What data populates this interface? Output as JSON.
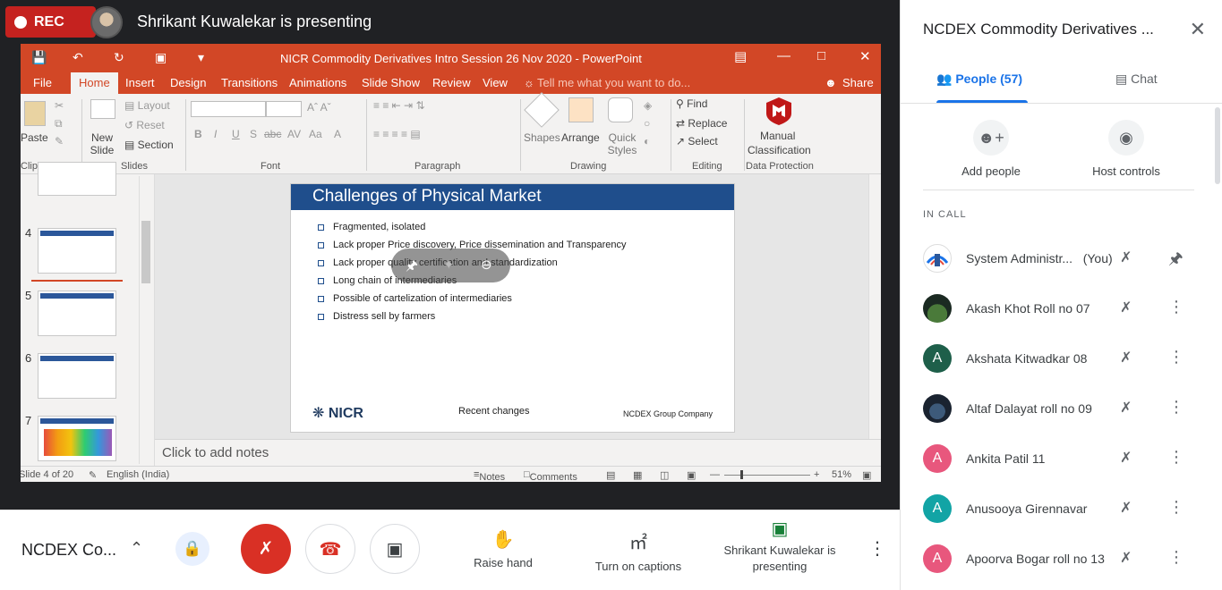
{
  "meet": {
    "rec_label": "REC",
    "presenter_title": "Shrikant Kuwalekar is presenting",
    "meeting_name": "NCDEX Co...",
    "raise_hand": "Raise hand",
    "captions": "Turn on captions",
    "presenting_label": "Shrikant Kuwalekar is presenting"
  },
  "ppt": {
    "doc_title": "NICR Commodity Derivatives Intro Session 26 Nov 2020 - PowerPoint",
    "tabs": [
      "File",
      "Home",
      "Insert",
      "Design",
      "Transitions",
      "Animations",
      "Slide Show",
      "Review",
      "View"
    ],
    "tell_me": "Tell me what you want to do...",
    "share": "Share",
    "ribbon": {
      "paste": "Paste",
      "new_slide": "New Slide",
      "layout": "Layout",
      "reset": "Reset",
      "section": "Section",
      "shapes": "Shapes",
      "arrange": "Arrange",
      "quick_styles": "Quick Styles",
      "find": "Find",
      "replace": "Replace",
      "select": "Select",
      "manual": "Manual",
      "classification": "Classification",
      "groups": {
        "clipboard": "Clipboard",
        "slides": "Slides",
        "font": "Font",
        "paragraph": "Paragraph",
        "drawing": "Drawing",
        "editing": "Editing",
        "data_protection": "Data Protection"
      }
    },
    "thumb_numbers": [
      "4",
      "5",
      "6",
      "7"
    ],
    "slide": {
      "title": "Challenges of Physical Market",
      "bullets": [
        "Fragmented, isolated",
        "Lack proper Price discovery,  Price dissemination and Transparency",
        "Lack proper quality certification and standardization",
        "Long chain of intermediaries",
        "Possible of cartelization of intermediaries",
        "Distress sell by farmers"
      ],
      "logo": "NICR",
      "footer_mid": "Recent changes",
      "footer_right": "NCDEX Group Company"
    },
    "notes_placeholder": "Click to add notes",
    "status": {
      "slide_of": "Slide 4 of 20",
      "language": "English (India)",
      "notes": "Notes",
      "comments": "Comments",
      "zoom": "51%"
    }
  },
  "side": {
    "title": "NCDEX Commodity Derivatives ...",
    "people_tab": "People (57)",
    "chat_tab": "Chat",
    "add_people": "Add people",
    "host_controls": "Host controls",
    "in_call": "IN CALL",
    "participants": [
      {
        "name": "System Administr...",
        "suffix": "(You)",
        "initial": "",
        "color": "#ffffff"
      },
      {
        "name": "Akash Khot Roll no 07",
        "initial": "",
        "color": "#2e4a3a"
      },
      {
        "name": "Akshata Kitwadkar 08",
        "initial": "A",
        "color": "#1e5f4a"
      },
      {
        "name": "Altaf Dalayat roll no 09",
        "initial": "",
        "color": "#2c3e55"
      },
      {
        "name": "Ankita Patil 11",
        "initial": "A",
        "color": "#e8577d"
      },
      {
        "name": "Anusooya Girennavar",
        "initial": "A",
        "color": "#12a4a5"
      },
      {
        "name": "Apoorva Bogar roll no 13",
        "initial": "A",
        "color": "#e8577d"
      }
    ]
  }
}
